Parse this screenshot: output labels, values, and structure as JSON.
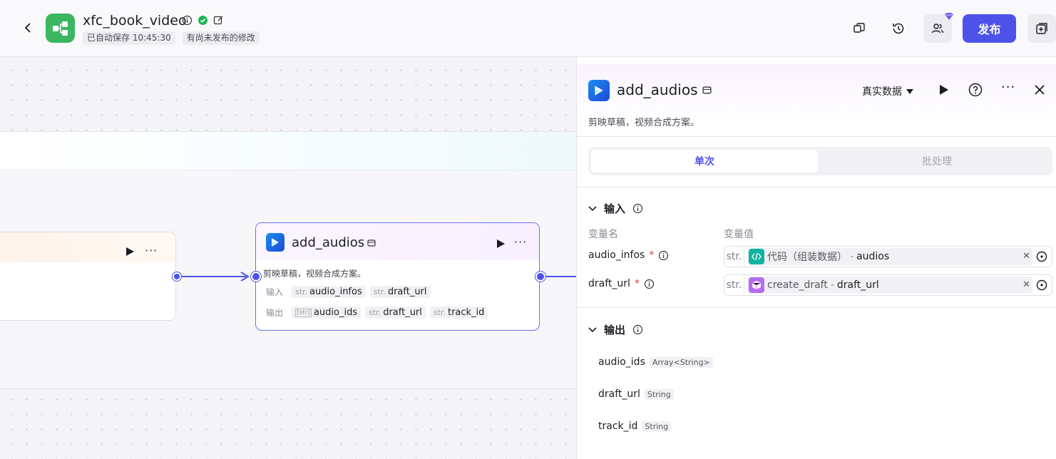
{
  "header": {
    "app_title": "xfc_book_video",
    "autosave_text": "已自动保存 10:45:30",
    "unpublished_text": "有尚未发布的修改",
    "publish_label": "发布",
    "colors": {
      "accent": "#4d53e8",
      "logo_bg": "#3cb660",
      "ok": "#1fb356"
    }
  },
  "canvas": {
    "prev_node": {},
    "node": {
      "title": "add_audios",
      "description": "剪映草稿，视频合成方案。",
      "input_label": "输入",
      "output_label": "输出",
      "inputs": [
        {
          "type": "str.",
          "name": "audio_infos"
        },
        {
          "type": "str.",
          "name": "draft_url"
        }
      ],
      "outputs": [
        {
          "type": "[str]",
          "name": "audio_ids"
        },
        {
          "type": "str.",
          "name": "draft_url"
        },
        {
          "type": "str.",
          "name": "track_id"
        }
      ]
    }
  },
  "panel": {
    "title": "add_audios",
    "description": "剪映草稿，视频合成方案。",
    "data_mode": "真实数据",
    "tabs": {
      "single": "单次",
      "batch": "批处理"
    },
    "input_section": "输入",
    "col_name": "变量名",
    "col_value": "变量值",
    "inputs": [
      {
        "name": "audio_infos",
        "type": "str.",
        "source": "代码（组装数据）",
        "var": "audios",
        "source_color": "#11b39f"
      },
      {
        "name": "draft_url",
        "type": "str.",
        "source": "create_draft",
        "var": "draft_url",
        "source_color": "#b36df0"
      }
    ],
    "output_section": "输出",
    "outputs": [
      {
        "name": "audio_ids",
        "type": "Array<String>"
      },
      {
        "name": "draft_url",
        "type": "String"
      },
      {
        "name": "track_id",
        "type": "String"
      }
    ]
  }
}
